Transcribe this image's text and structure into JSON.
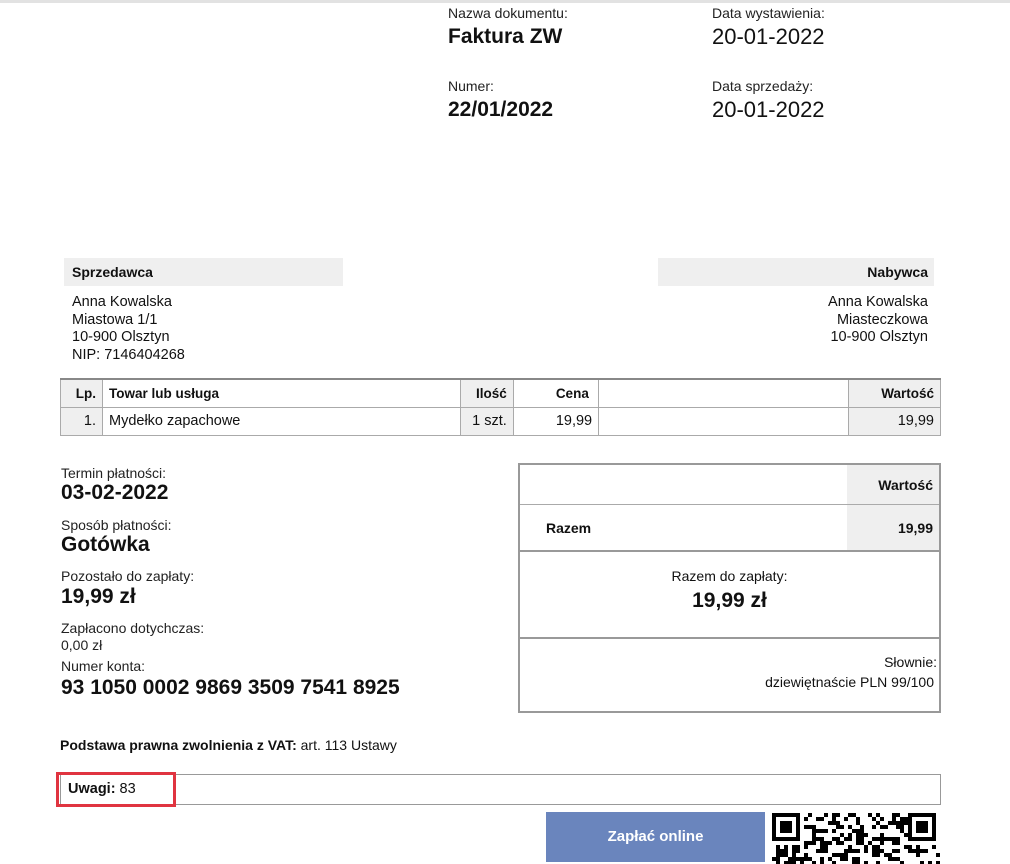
{
  "header": {
    "doc_name_label": "Nazwa dokumentu:",
    "doc_name": "Faktura ZW",
    "issue_date_label": "Data wystawienia:",
    "issue_date": "20-01-2022",
    "number_label": "Numer:",
    "number": "22/01/2022",
    "sale_date_label": "Data sprzedaży:",
    "sale_date": "20-01-2022"
  },
  "seller": {
    "heading": "Sprzedawca",
    "name": "Anna Kowalska",
    "street": "Miastowa 1/1",
    "city": "10-900 Olsztyn",
    "nip": "NIP: 7146404268"
  },
  "buyer": {
    "heading": "Nabywca",
    "name": "Anna Kowalska",
    "street": "Miasteczkowa",
    "city": "10-900 Olsztyn"
  },
  "items_table": {
    "headers": [
      "Lp.",
      "Towar lub usługa",
      "Ilość",
      "Cena",
      "Wartość"
    ],
    "rows": [
      [
        "1.",
        "Mydełko zapachowe",
        "1 szt.",
        "19,99",
        "19,99"
      ]
    ]
  },
  "payment": {
    "due_label": "Termin płatności:",
    "due": "03-02-2022",
    "method_label": "Sposób płatności:",
    "method": "Gotówka",
    "remaining_label": "Pozostało do zapłaty:",
    "remaining": "19,99 zł",
    "paid_label": "Zapłacono dotychczas:",
    "paid": "0,00 zł",
    "account_label": "Numer konta:",
    "account": "93 1050 0002 9869 3509 7541 8925"
  },
  "summary": {
    "value_header": "Wartość",
    "total_label": "Razem",
    "total_value": "19,99",
    "to_pay_label": "Razem do zapłaty:",
    "to_pay": "19,99 zł",
    "words_label": "Słownie:",
    "words": "dziewiętnaście PLN 99/100"
  },
  "vat_basis": {
    "label": "Podstawa prawna zwolnienia z VAT:",
    "value": " art. 113 Ustawy"
  },
  "notes": {
    "label": "Uwagi:",
    "value": " 83"
  },
  "pay_button": "Zapłać online",
  "colors": {
    "pay_button": "#6a85bd",
    "highlight": "#e03440",
    "header_bg": "#efefef"
  }
}
